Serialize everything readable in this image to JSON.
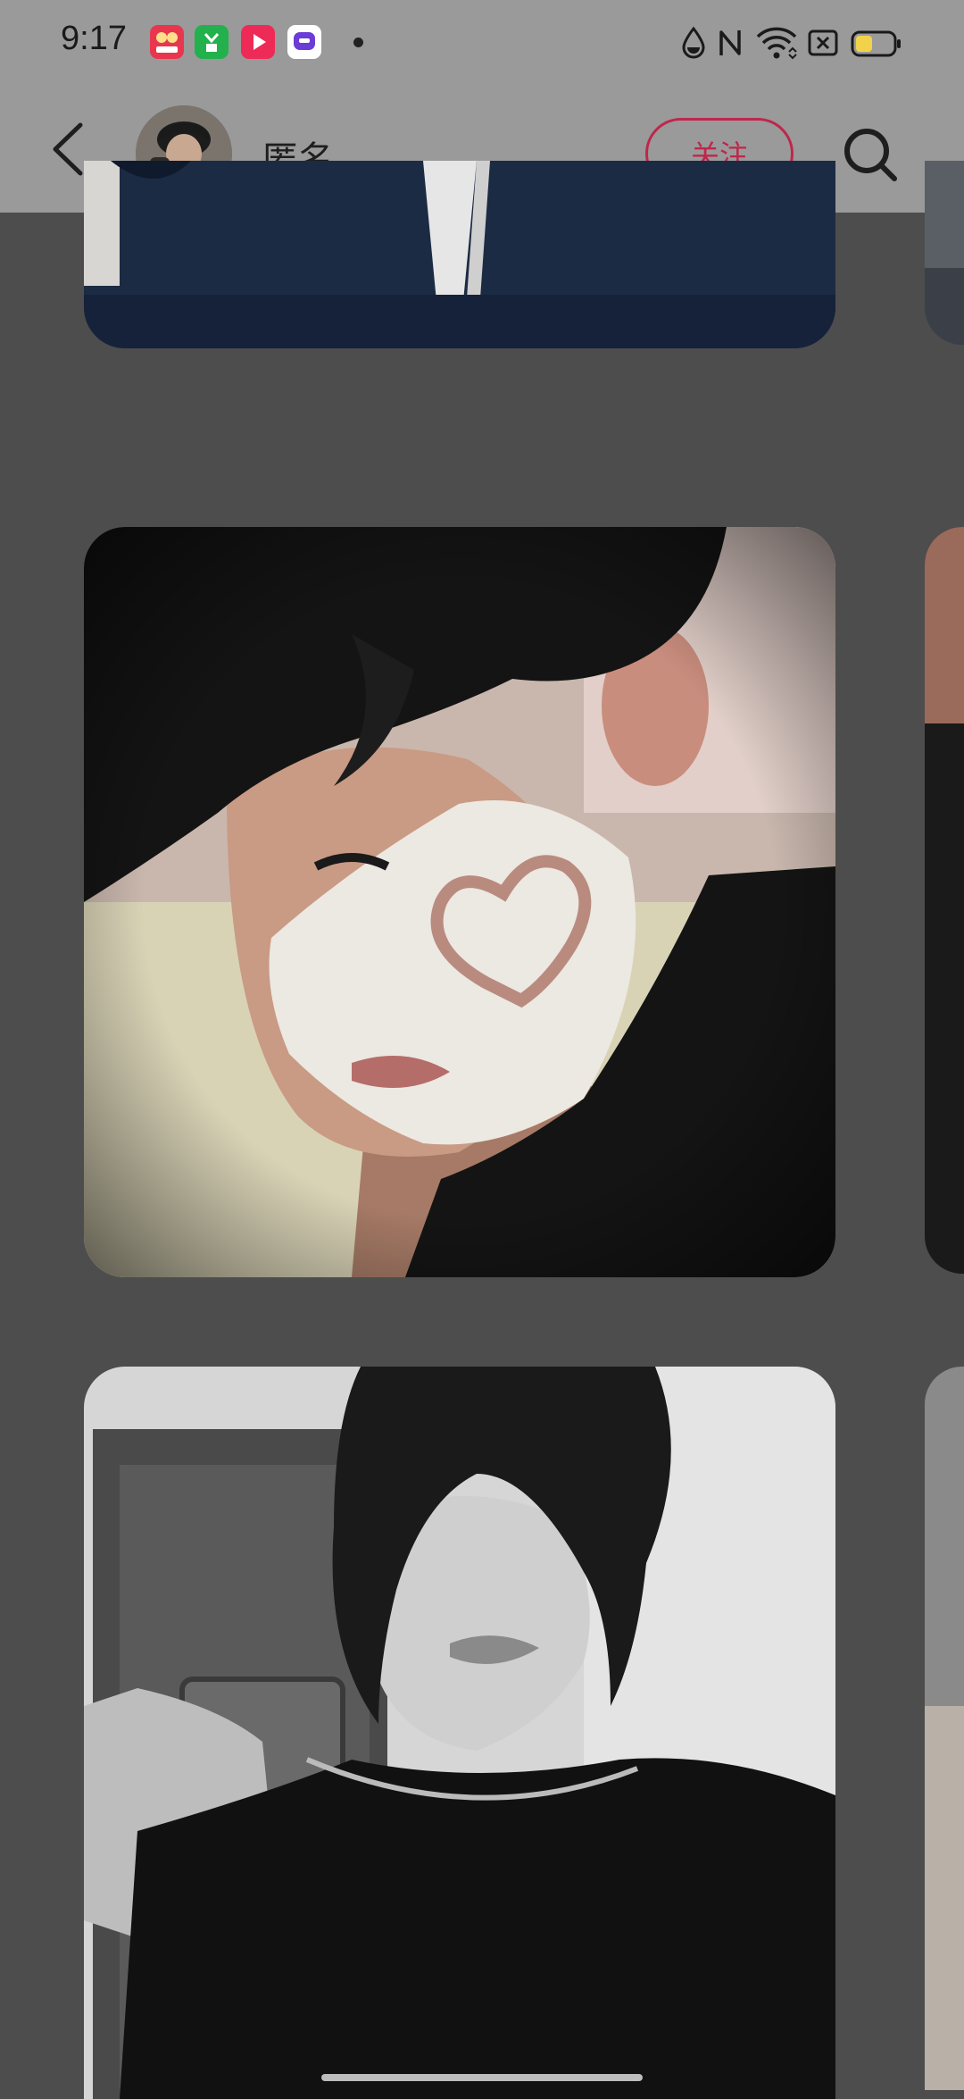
{
  "status_bar": {
    "time": "9:17",
    "notification_icons": [
      "app-icon-pink-camera",
      "app-icon-green",
      "app-icon-red-play",
      "app-icon-purple-chat"
    ]
  },
  "header": {
    "profile_name": "匿名",
    "follow_label": "关注"
  },
  "colors": {
    "accent": "#c0264b",
    "overlay_background": "#4d4d4d",
    "header_background": "#9a9a9a"
  },
  "gallery": {
    "photos": [
      "photo-dark-hoodie",
      "photo-face-mask-heart",
      "photo-black-white-selfie"
    ]
  }
}
